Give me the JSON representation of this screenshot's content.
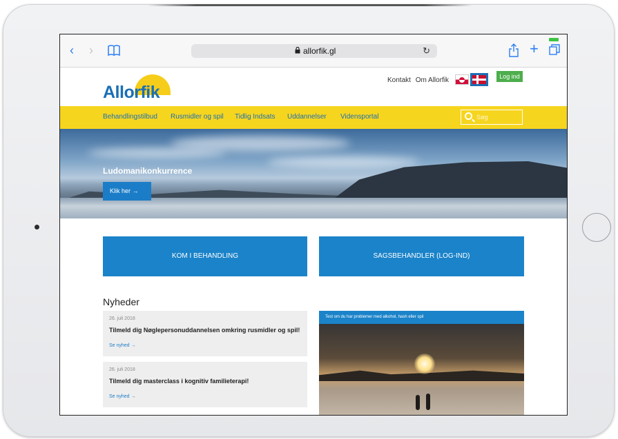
{
  "browser": {
    "url": "allorfik.gl",
    "back_icon": "‹",
    "forward_icon": "›",
    "reload_icon": "↻",
    "plus_icon": "+"
  },
  "site": {
    "logo_text": "Allorfik",
    "toplinks": [
      "Kontakt",
      "Om Allorfik"
    ],
    "login_label": "Log ind",
    "menu": [
      "Behandlingstilbud",
      "Rusmidler og spil",
      "Tidlig Indsats",
      "Uddannelser",
      "Vidensportal"
    ],
    "search_placeholder": "Søg",
    "colors": {
      "brand_blue": "#1b83c9",
      "brand_yellow": "#f6d51f",
      "login_green": "#4cae4c"
    }
  },
  "hero": {
    "title": "Ludomanikonkurrence",
    "button_label": "Klik her →"
  },
  "tiles": [
    "KOM I BEHANDLING",
    "SAGSBEHANDLER (LOG-IND)"
  ],
  "news": {
    "heading": "Nyheder",
    "items": [
      {
        "date": "26. juli 2018",
        "title": "Tilmeld dig Nøglepersonuddannelsen omkring rusmidler og spil!",
        "link": "Se nyhed →"
      },
      {
        "date": "26. juli 2018",
        "title": "Tilmeld dig masterclass i kognitiv familieterapi!",
        "link": "Se nyhed →"
      }
    ],
    "feature_caption": "Test om du har problemer med alkohol, hash eller spil"
  }
}
